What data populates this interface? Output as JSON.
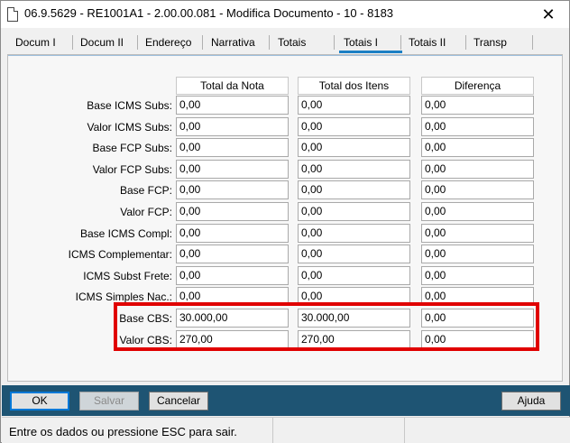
{
  "window": {
    "title": "06.9.5629 - RE1001A1 - 2.00.00.081 - Modifica Documento - 10 - 8183",
    "close_glyph": "✕"
  },
  "tabs": [
    {
      "label": "Docum I"
    },
    {
      "label": "Docum II"
    },
    {
      "label": "Endereço"
    },
    {
      "label": "Narrativa"
    },
    {
      "label": "Totais"
    },
    {
      "label": "Totais I",
      "active": true
    },
    {
      "label": "Totais II"
    },
    {
      "label": "Transp"
    }
  ],
  "table": {
    "columns": [
      "Total da Nota",
      "Total dos Itens",
      "Diferença"
    ],
    "rows": [
      {
        "label": "Base ICMS Subs:",
        "values": [
          "0,00",
          "0,00",
          "0,00"
        ]
      },
      {
        "label": "Valor ICMS Subs:",
        "values": [
          "0,00",
          "0,00",
          "0,00"
        ]
      },
      {
        "label": "Base FCP Subs:",
        "values": [
          "0,00",
          "0,00",
          "0,00"
        ]
      },
      {
        "label": "Valor FCP Subs:",
        "values": [
          "0,00",
          "0,00",
          "0,00"
        ]
      },
      {
        "label": "Base FCP:",
        "values": [
          "0,00",
          "0,00",
          "0,00"
        ]
      },
      {
        "label": "Valor FCP:",
        "values": [
          "0,00",
          "0,00",
          "0,00"
        ]
      },
      {
        "label": "Base ICMS Compl:",
        "values": [
          "0,00",
          "0,00",
          "0,00"
        ]
      },
      {
        "label": "ICMS Complementar:",
        "values": [
          "0,00",
          "0,00",
          "0,00"
        ]
      },
      {
        "label": "ICMS Subst Frete:",
        "values": [
          "0,00",
          "0,00",
          "0,00"
        ]
      },
      {
        "label": "ICMS Simples Nac.:",
        "values": [
          "0,00",
          "0,00",
          "0,00"
        ]
      },
      {
        "label": "Base CBS:",
        "values": [
          "30.000,00",
          "30.000,00",
          "0,00"
        ]
      },
      {
        "label": "Valor CBS:",
        "values": [
          "270,00",
          "270,00",
          "0,00"
        ]
      }
    ]
  },
  "buttons": {
    "ok": "OK",
    "salvar": "Salvar",
    "cancelar": "Cancelar",
    "ajuda": "Ajuda"
  },
  "status": {
    "message": "Entre os dados ou pressione ESC para sair."
  },
  "colors": {
    "highlight": "#e00000",
    "button_bar": "#1e5473",
    "active_tab": "#1b7fc4"
  }
}
